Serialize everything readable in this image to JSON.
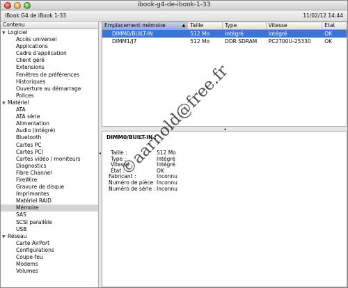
{
  "window": {
    "title": "ibook-g4-de-ibook-1-33"
  },
  "infobar": {
    "machine": "iBook G4 de iBook 1-33",
    "date": "11/02/12 14:44"
  },
  "sidebar": {
    "header": "Contenu",
    "groups": [
      {
        "label": "Logiciel",
        "items": [
          "Accès universel",
          "Applications",
          "Cadre d'application",
          "Client géré",
          "Extensions",
          "Fenêtres de préférences",
          "Historiques",
          "Ouverture au démarrage",
          "Polices"
        ]
      },
      {
        "label": "Matériel",
        "items": [
          "ATA",
          "ATA série",
          "Alimentation",
          "Audio (intégré)",
          "Bluetooth",
          "Cartes PC",
          "Cartes PCI",
          "Cartes vidéo / moniteurs",
          "Diagnostics",
          "Fibre Channel",
          "FireWire",
          "Gravure de disque",
          "Imprimantes",
          "Matériel RAID",
          "Mémoire",
          "SAS",
          "SCSI parallèle",
          "USB"
        ]
      },
      {
        "label": "Réseau",
        "items": [
          "Carte AirPort",
          "Configurations",
          "Coupe-feu",
          "Modems",
          "Volumes"
        ]
      }
    ],
    "selected": "Mémoire"
  },
  "table": {
    "columns": [
      "Emplacement mémoire",
      "Taille",
      "Type",
      "Vitesse",
      "État"
    ],
    "rows": [
      [
        "DIMM0/BUILT-IN",
        "512 Mo",
        "Intégré",
        "Intégré",
        "OK"
      ],
      [
        "DIMM1/J7",
        "512 Mo",
        "DDR SDRAM",
        "PC2700U-25330",
        "OK"
      ]
    ]
  },
  "detail": {
    "title": "DIMM0/BUILT-IN :",
    "fields": [
      {
        "key": "Taille :",
        "value": "512 Mo"
      },
      {
        "key": "Type :",
        "value": "Intégré"
      },
      {
        "key": "Vitesse :",
        "value": "Intégré"
      },
      {
        "key": "État :",
        "value": "OK"
      },
      {
        "key": "Fabricant :",
        "value": "Inconnu"
      },
      {
        "key": "Numéro de pièce :",
        "value": "Inconnu"
      },
      {
        "key": "Numéro de série :",
        "value": "Inconnu"
      }
    ]
  },
  "watermark": "©aarnold@free.fr",
  "colors": {
    "selection": "#3875d7",
    "sidebar_selection": "#d4d4d4"
  }
}
